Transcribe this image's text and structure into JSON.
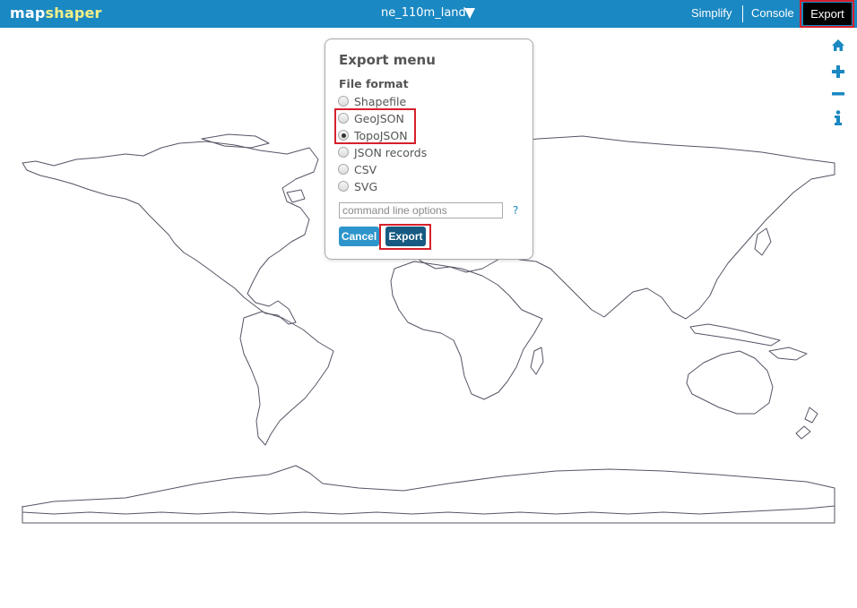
{
  "app": {
    "logo_part1": "map",
    "logo_part2": "shaper",
    "layer_name": "ne_110m_land"
  },
  "nav": {
    "simplify": "Simplify",
    "console": "Console",
    "export": "Export"
  },
  "tools": [
    "home-icon",
    "zoom-in-icon",
    "zoom-out-icon",
    "info-icon"
  ],
  "export_menu": {
    "title": "Export menu",
    "file_format_label": "File format",
    "formats": [
      {
        "label": "Shapefile",
        "selected": false
      },
      {
        "label": "GeoJSON",
        "selected": false
      },
      {
        "label": "TopoJSON",
        "selected": true
      },
      {
        "label": "JSON records",
        "selected": false
      },
      {
        "label": "CSV",
        "selected": false
      },
      {
        "label": "SVG",
        "selected": false
      }
    ],
    "command_placeholder": "command line options",
    "help": "?",
    "cancel_label": "Cancel",
    "export_label": "Export"
  },
  "colors": {
    "topbar": "#1a88c2",
    "logo_accent": "#f3ef86",
    "highlight": "#d6202b",
    "map_outline": "#555566"
  }
}
